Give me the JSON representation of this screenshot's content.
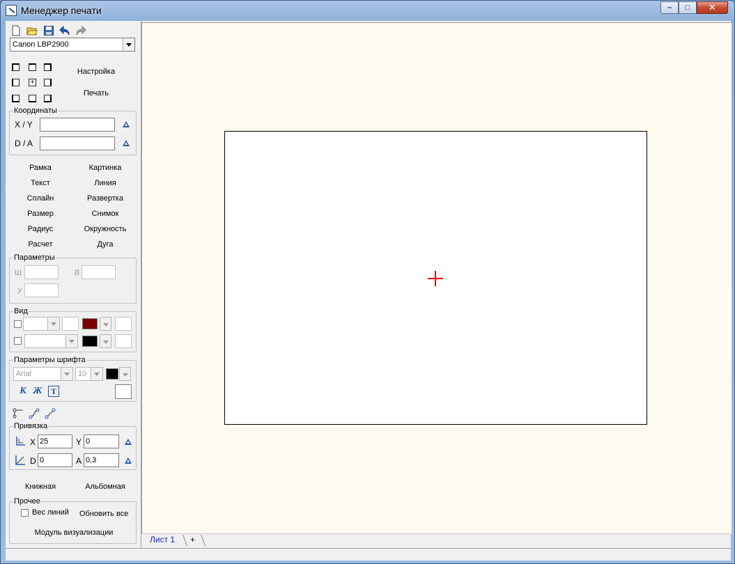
{
  "window": {
    "title": "Менеджер печати",
    "controls": {
      "minimize": "–",
      "maximize": "□",
      "close": "✕"
    }
  },
  "toolbar": {
    "icons": [
      "new-file-icon",
      "open-folder-icon",
      "save-icon",
      "undo-icon",
      "redo-icon"
    ]
  },
  "printer": {
    "selected": "Canon LBP2900"
  },
  "actions": {
    "settings_label": "Настройка",
    "print_label": "Печать"
  },
  "coordinates": {
    "title": "Координаты",
    "xy_label": "X / Y",
    "xy_value": "",
    "da_label": "D / A",
    "da_value": ""
  },
  "tools": [
    [
      "Рамка",
      "Картинка"
    ],
    [
      "Текст",
      "Линия"
    ],
    [
      "Сплайн",
      "Развертка"
    ],
    [
      "Размер",
      "Снимок"
    ],
    [
      "Радиус",
      "Окружность"
    ],
    [
      "Расчет",
      "Дуга"
    ]
  ],
  "params": {
    "title": "Параметры",
    "w_label": "Ш",
    "h_label": "В",
    "u_label": "У"
  },
  "view": {
    "title": "Вид"
  },
  "font": {
    "title": "Параметры шрифта",
    "family": "Arial",
    "size": "10",
    "italic": "К",
    "bold": "Ж",
    "text": "Т"
  },
  "snap": {
    "title": "Привязка",
    "x_label": "X",
    "x_value": "25",
    "y_label": "Y",
    "y_value": "0",
    "d_label": "D",
    "d_value": "0",
    "a_label": "A",
    "a_value": "0,3"
  },
  "orientation": {
    "portrait": "Книжная",
    "landscape": "Альбомная"
  },
  "other": {
    "title": "Прочее",
    "line_weight": "Вес линий",
    "refresh_all": "Обновить все",
    "visual_module": "Модуль визуализации"
  },
  "tabs": {
    "sheet1": "Лист 1",
    "add": "+"
  },
  "colors": {
    "line_color": "#7a0000",
    "fill_color": "#000000",
    "font_color": "#000000",
    "crosshair": "#e00000"
  }
}
